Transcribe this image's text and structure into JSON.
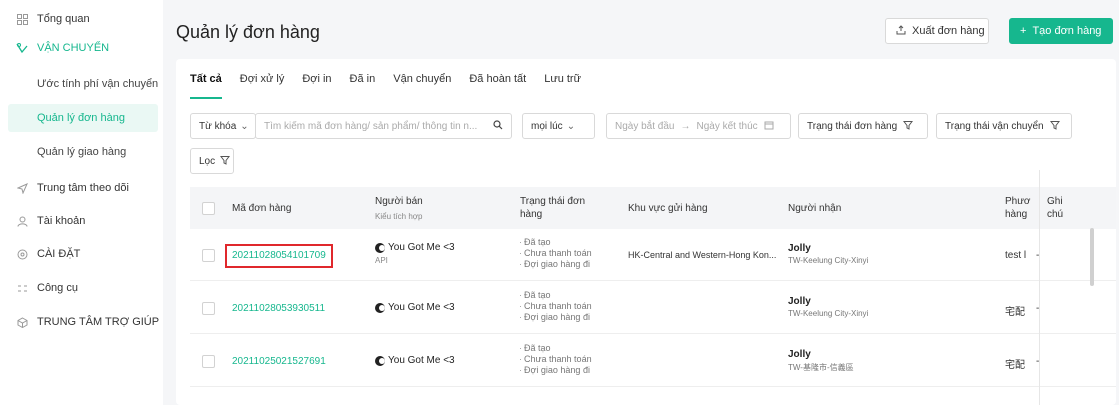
{
  "sidebar": {
    "items": [
      {
        "label": "Tổng quan",
        "icon": "grid-icon"
      },
      {
        "label": "VẬN CHUYỂN",
        "icon": "shipping-icon"
      },
      {
        "label": "Trung tâm theo dõi",
        "icon": "send-icon"
      },
      {
        "label": "Tài khoản",
        "icon": "user-icon"
      },
      {
        "label": "CÀI ĐẶT",
        "icon": "settings-icon"
      },
      {
        "label": "Công cụ",
        "icon": "tools-icon"
      },
      {
        "label": "TRUNG TÂM TRỢ GIÚP",
        "icon": "help-icon"
      }
    ],
    "shipping_sub": [
      {
        "label": "Ước tính phí vận chuyển"
      },
      {
        "label": "Quản lý đơn hàng"
      },
      {
        "label": "Quản lý giao hàng"
      }
    ]
  },
  "header": {
    "title": "Quản lý đơn hàng",
    "export_label": "Xuất đơn hàng",
    "create_label": "Tạo đơn hàng"
  },
  "tabs": [
    "Tất cả",
    "Đợi xử lý",
    "Đợi in",
    "Đã in",
    "Vận chuyển",
    "Đã hoàn tất",
    "Lưu trữ"
  ],
  "filters": {
    "keyword_select": "Từ khóa",
    "search_placeholder": "Tìm kiếm mã đơn hàng/ sản phẩm/ thông tin n...",
    "time_select": "mọi lúc",
    "start_date_placeholder": "Ngày bắt đầu",
    "end_date_placeholder": "Ngày kết thúc",
    "order_status": "Trạng thái đơn hàng",
    "shipping_status": "Trạng thái vận chuyển",
    "filter_label": "Lọc"
  },
  "table": {
    "headers": {
      "order_id": "Mã đơn hàng",
      "seller": "Người bán",
      "seller_sub": "Kiểu tích hợp",
      "order_status": "Trạng thái đơn hàng",
      "pickup_area": "Khu vực gửi hàng",
      "receiver": "Người nhận",
      "method": "Phươ hàng",
      "note": "Ghi chú"
    },
    "rows": [
      {
        "order_id": "20211028054101709",
        "seller": "You Got Me <3",
        "integration": "API",
        "statuses": [
          "Đã tạo",
          "Chưa thanh toán",
          "Đợi giao hàng đi"
        ],
        "pickup_area": "HK-Central and Western-Hong Kon...",
        "receiver_name": "Jolly",
        "receiver_addr": "TW-Keelung City-Xinyi",
        "method": "test l",
        "note": "-"
      },
      {
        "order_id": "20211028053930511",
        "seller": "You Got Me <3",
        "integration": "",
        "statuses": [
          "Đã tạo",
          "Chưa thanh toán",
          "Đợi giao hàng đi"
        ],
        "pickup_area": "",
        "receiver_name": "Jolly",
        "receiver_addr": "TW-Keelung City-Xinyi",
        "method": "宅配",
        "note": "-"
      },
      {
        "order_id": "20211025021527691",
        "seller": "You Got Me <3",
        "integration": "",
        "statuses": [
          "Đã tạo",
          "Chưa thanh toán",
          "Đợi giao hàng đi"
        ],
        "pickup_area": "",
        "receiver_name": "Jolly",
        "receiver_addr": "TW-基隆市-信義區",
        "method": "宅配",
        "note": "-"
      }
    ]
  },
  "colors": {
    "accent": "#16b78e",
    "highlight": "#e0282c"
  }
}
